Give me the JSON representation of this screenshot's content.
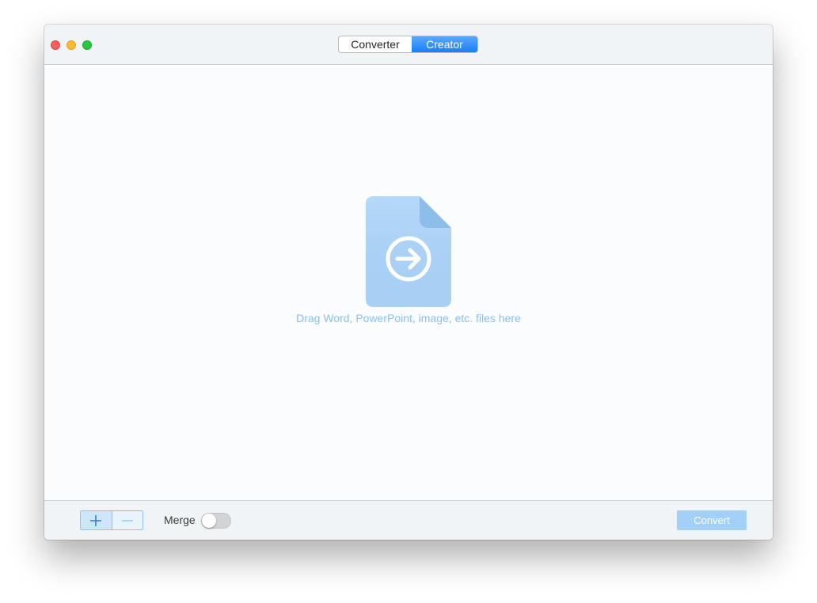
{
  "titlebar": {
    "tabs": [
      {
        "label": "Converter",
        "selected": false
      },
      {
        "label": "Creator",
        "selected": true
      }
    ]
  },
  "dropzone": {
    "icon": "document-arrow-icon",
    "hint": "Drag Word, PowerPoint, image, etc. files here"
  },
  "bottombar": {
    "add_icon": "plus-icon",
    "remove_icon": "minus-icon",
    "merge_label": "Merge",
    "merge_enabled": false,
    "convert_label": "Convert",
    "convert_enabled": false
  },
  "colors": {
    "accent": "#1a7ef5",
    "hint_text": "#8bbfec",
    "file_icon": "#a8d0f5",
    "convert_disabled": "#a3d0f6"
  }
}
